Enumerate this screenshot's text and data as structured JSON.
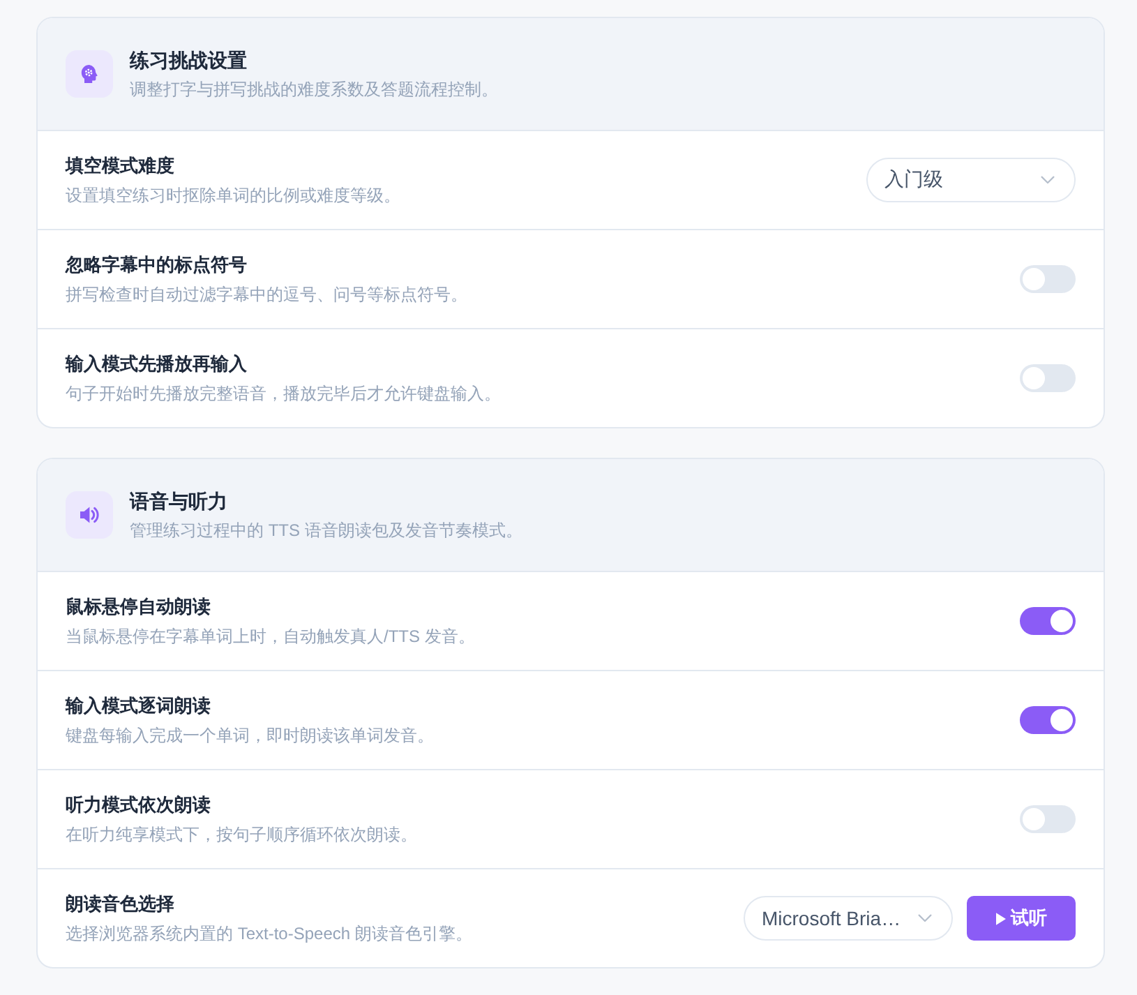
{
  "sections": [
    {
      "title": "练习挑战设置",
      "description": "调整打字与拼写挑战的难度系数及答题流程控制。",
      "settings": [
        {
          "kind": "select",
          "label": "填空模式难度",
          "description": "设置填空练习时抠除单词的比例或难度等级。",
          "value": "入门级"
        },
        {
          "kind": "toggle",
          "label": "忽略字幕中的标点符号",
          "description": "拼写检查时自动过滤字幕中的逗号、问号等标点符号。",
          "on": false
        },
        {
          "kind": "toggle",
          "label": "输入模式先播放再输入",
          "description": "句子开始时先播放完整语音，播放完毕后才允许键盘输入。",
          "on": false
        }
      ]
    },
    {
      "title": "语音与听力",
      "description": "管理练习过程中的 TTS 语音朗读包及发音节奏模式。",
      "settings": [
        {
          "kind": "toggle",
          "label": "鼠标悬停自动朗读",
          "description": "当鼠标悬停在字幕单词上时，自动触发真人/TTS 发音。",
          "on": true
        },
        {
          "kind": "toggle",
          "label": "输入模式逐词朗读",
          "description": "键盘每输入完成一个单词，即时朗读该单词发音。",
          "on": true
        },
        {
          "kind": "toggle",
          "label": "听力模式依次朗读",
          "description": "在听力纯享模式下，按句子顺序循环依次朗读。",
          "on": false
        },
        {
          "kind": "select",
          "label": "朗读音色选择",
          "description": "选择浏览器系统内置的 Text-to-Speech 朗读音色引擎。",
          "value": "Microsoft Bria…",
          "button": "试听"
        }
      ]
    }
  ]
}
